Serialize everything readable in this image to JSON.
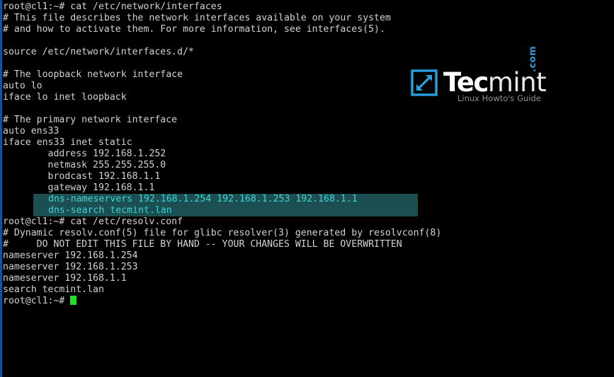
{
  "terminal": {
    "background_color": "#000000",
    "text_color": "#d2d2d2",
    "accent_bar_color": "#1b4f9c",
    "highlight_background_color": "#1b4f52",
    "highlight_text_color": "#3fd4d4",
    "cursor_color": "#19e619",
    "lines": [
      "root@cl1:~# cat /etc/network/interfaces",
      "# This file describes the network interfaces available on your system",
      "# and how to activate them. For more information, see interfaces(5).",
      "",
      "source /etc/network/interfaces.d/*",
      "",
      "# The loopback network interface",
      "auto lo",
      "iface lo inet loopback",
      "",
      "# The primary network interface",
      "auto ens33",
      "iface ens33 inet static",
      "        address 192.168.1.252",
      "        netmask 255.255.255.0",
      "        brodcast 192.168.1.1",
      "        gateway 192.168.1.1"
    ],
    "highlighted_lines": [
      "dns-nameservers 192.168.1.254 192.168.1.253 192.168.1.1",
      "dns-search tecmint.lan"
    ],
    "lines_after_highlight": [
      "root@cl1:~# cat /etc/resolv.conf",
      "# Dynamic resolv.conf(5) file for glibc resolver(3) generated by resolvconf(8)",
      "#     DO NOT EDIT THIS FILE BY HAND -- YOUR CHANGES WILL BE OVERWRITTEN",
      "nameserver 192.168.1.254",
      "nameserver 192.168.1.253",
      "nameserver 192.168.1.1",
      "search tecmint.lan"
    ],
    "final_prompt": "root@cl1:~# "
  },
  "logo": {
    "name_bold": "Tec",
    "name_light": "mint",
    "tld": ".com",
    "tagline": "Linux Howto's Guide",
    "mark_color": "#2a9fe0",
    "tld_color": "#2a9fe0",
    "tagline_color": "#8f8f8f"
  }
}
